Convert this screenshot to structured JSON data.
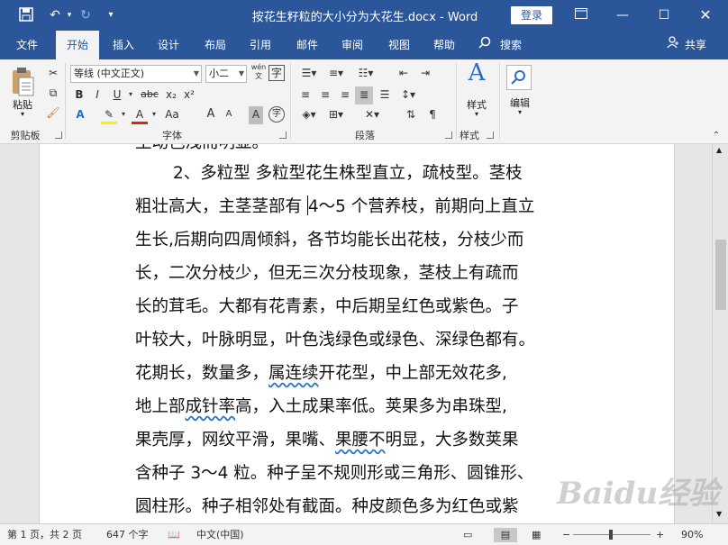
{
  "titlebar": {
    "doc_title": "按花生籽粒的大小分为大花生.docx - Word",
    "login_label": "登录",
    "icons": [
      "save-icon",
      "undo-icon",
      "redo-icon",
      "customize-quick-access-icon",
      "ribbon-display-options-icon",
      "minimize-icon",
      "maximize-icon",
      "close-icon"
    ]
  },
  "tabs": [
    {
      "label": "文件"
    },
    {
      "label": "开始"
    },
    {
      "label": "插入"
    },
    {
      "label": "设计"
    },
    {
      "label": "布局"
    },
    {
      "label": "引用"
    },
    {
      "label": "邮件"
    },
    {
      "label": "审阅"
    },
    {
      "label": "视图"
    },
    {
      "label": "帮助"
    }
  ],
  "search_label": "搜索",
  "share_label": "共享",
  "ribbon": {
    "clipboard": {
      "paste_label": "粘贴",
      "group_label": "剪贴板"
    },
    "font": {
      "font_name": "等线 (中文正文)",
      "font_size": "小二",
      "wen_label": "wén",
      "group_label": "字体",
      "buttons": [
        "B",
        "I",
        "U",
        "abc",
        "x₂",
        "x²",
        "A",
        "A",
        "Aa",
        "A",
        "A",
        "A",
        "字"
      ]
    },
    "paragraph": {
      "group_label": "段落"
    },
    "styles": {
      "label": "样式",
      "group_label": "样式"
    },
    "editing": {
      "label": "编辑"
    }
  },
  "document": {
    "top_partial": "生动色浅而明显。",
    "lines": [
      "2、多粒型  多粒型花生株型直立，疏枝型。茎枝",
      "粗壮高大，主茎茎部有",
      "生长,后期向四周倾斜，各节均能长出花枝，分枝少而",
      "长，二次分枝少，但无三次分枝现象，茎枝上有疏而",
      "长的茸毛。大都有花青素，中后期呈红色或紫色。子",
      "叶较大，叶脉明显，叶色浅绿色或绿色、深绿色都有。",
      "花期长，数量多，",
      "地上部",
      "果壳厚，网纹平滑，果嘴、",
      "含种子 3～4 粒。种子呈不规则形或三角形、圆锥形、",
      "圆柱形。种子相邻处有截面。种皮颜色多为红色或紫"
    ],
    "line2_after_cursor": "4～5 个营养枝，前期向上直立",
    "line7_wavy": "属连续",
    "line7_rest": "开花型，中上部无效花多,",
    "line8_wavy": "成针率",
    "line8_rest": "高，入土成果率低。荚果多为串珠型,",
    "line9_wavy": "果腰不",
    "line9_rest": "明显，大多数荚果"
  },
  "watermark": "Baidu经验",
  "status": {
    "page": "第 1 页，共 2 页",
    "words": "647 个字",
    "language": "中文(中国)",
    "zoom_minus": "−",
    "zoom_plus": "+",
    "zoom": "90%"
  }
}
